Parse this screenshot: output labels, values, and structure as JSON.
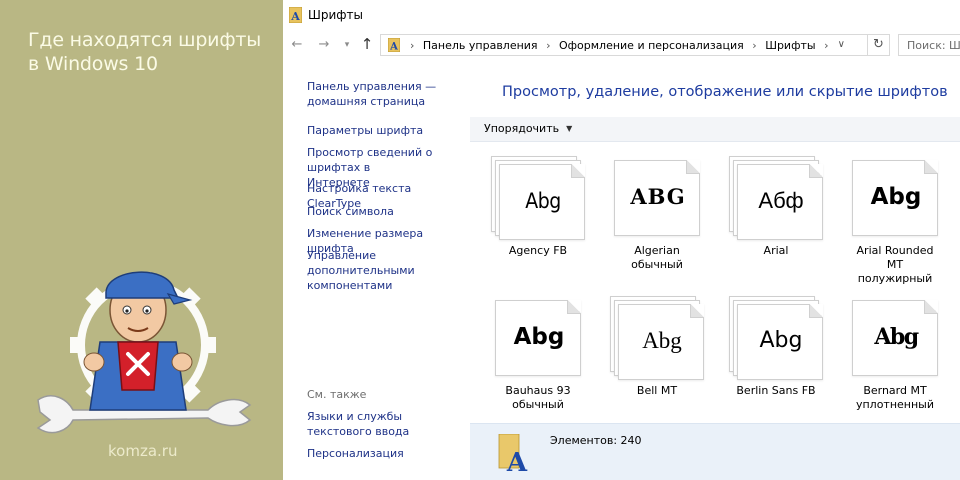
{
  "promo": {
    "title_line1": "Где находятся шрифты",
    "title_line2": "в Windows 10",
    "site": "komza.ru"
  },
  "window": {
    "title": "Шрифты",
    "address": {
      "crumbs": [
        "Панель управления",
        "Оформление и персонализация",
        "Шрифты"
      ]
    },
    "search_placeholder": "Поиск: Шрифты"
  },
  "leftpane": {
    "home_link": "Панель управления — домашняя страница",
    "links": [
      "Параметры шрифта",
      "Просмотр сведений о шрифтах в Интернете",
      "Настройка текста ClearType",
      "Поиск символа",
      "Изменение размера шрифта",
      "Управление дополнительными компонентами"
    ],
    "see_also": "См. также",
    "see_also_links": [
      "Языки и службы текстового ввода",
      "Персонализация"
    ]
  },
  "main": {
    "heading": "Просмотр, удаление, отображение или скрытие шрифтов",
    "sort_label": "Упорядочить",
    "fonts": [
      {
        "name": "Agency FB",
        "sample": "Abg",
        "stacked": true
      },
      {
        "name": "Algerian обычный",
        "sample": "ABG",
        "stacked": false
      },
      {
        "name": "Arial",
        "sample": "Абф",
        "stacked": true
      },
      {
        "name": "Arial Rounded MT полужирный",
        "sample": "Abg",
        "stacked": false
      },
      {
        "name": "Bauhaus 93 обычный",
        "sample": "Abg",
        "stacked": false
      },
      {
        "name": "Bell MT",
        "sample": "Abg",
        "stacked": true
      },
      {
        "name": "Berlin Sans FB",
        "sample": "Abg",
        "stacked": true
      },
      {
        "name": "Bernard MT уплотненный",
        "sample": "Abg",
        "stacked": false
      }
    ],
    "details": "Элементов: 240"
  },
  "colors": {
    "link": "#1e3287",
    "heading": "#1e3ca0",
    "promo_bg": "#b9b784",
    "details_bg": "#eaf1f9"
  }
}
